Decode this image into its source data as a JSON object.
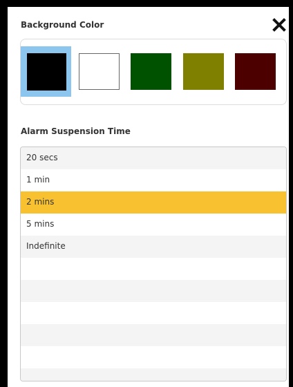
{
  "background_color": {
    "title": "Background Color",
    "selected_index": 0,
    "swatches": [
      {
        "name": "black",
        "color": "#000000"
      },
      {
        "name": "white",
        "color": "#ffffff"
      },
      {
        "name": "dark-green",
        "color": "#005200"
      },
      {
        "name": "olive",
        "color": "#808000"
      },
      {
        "name": "maroon",
        "color": "#4d0000"
      }
    ],
    "selection_highlight": "#8cc6ee"
  },
  "alarm_suspension": {
    "title": "Alarm Suspension Time",
    "options": [
      "20 secs",
      "1 min",
      "2 mins",
      "5 mins",
      "Indefinite"
    ],
    "selected": "2 mins",
    "selected_color": "#f7c12f"
  },
  "close_icon": "close-icon"
}
